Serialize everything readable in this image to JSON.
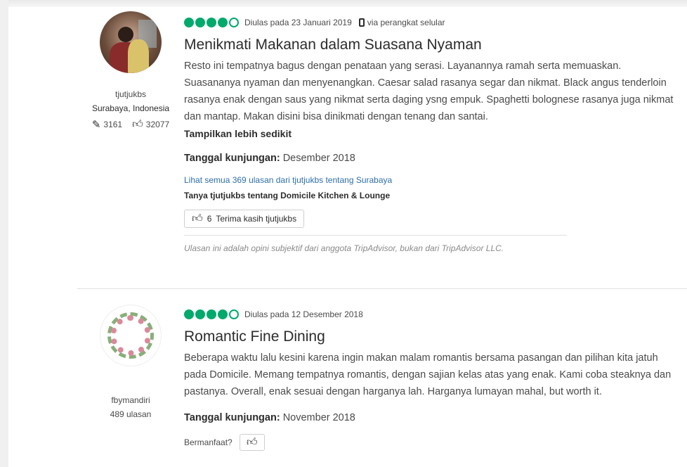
{
  "reviews": [
    {
      "member": {
        "name": "tjutjukbs",
        "location": "Surabaya, Indonesia",
        "contributions": "3161",
        "helpful_votes": "32077",
        "avatar_icon": "member-photo",
        "contrib_icon": "edit-icon",
        "votes_icon": "thumbs-up-icon"
      },
      "rating": 4,
      "reviewed_text": "Diulas pada 23 Januari 2019",
      "via_text": "via perangkat selular",
      "title": "Menikmati Makanan dalam Suasana Nyaman",
      "body": "Resto ini tempatnya bagus dengan penataan yang serasi. Layanannya ramah serta memuaskan. Suasananya nyaman dan menyenangkan. Caesar salad rasanya segar dan nikmat. Black angus tenderloin rasanya enak dengan saus yang nikmat serta daging ysng empuk. Spaghetti bolognese rasanya juga nikmat dan mantap. Makan disini bisa dinikmati dengan tenang dan santai.",
      "show_less": "Tampilkan lebih sedikit",
      "visit_label": "Tanggal kunjungan:",
      "visit_value": " Desember 2018",
      "see_all": "Lihat semua 369 ulasan dari tjutjukbs tentang Surabaya",
      "ask": "Tanya tjutjukbs tentang Domicile Kitchen & Lounge",
      "thanks_count": "6",
      "thanks_label": "Terima kasih tjutjukbs",
      "disclaimer": "Ulasan ini adalah opini subjektif dari anggota TripAdvisor, bukan dari TripAdvisor LLC."
    },
    {
      "member": {
        "name": "fbymandiri",
        "reviews_count": "489 ulasan",
        "avatar_icon": "floral-wreath-avatar"
      },
      "rating": 4,
      "reviewed_text": "Diulas pada 12 Desember 2018",
      "title": "Romantic Fine Dining",
      "body": "Beberapa waktu lalu kesini karena ingin makan malam romantis bersama pasangan dan pilihan kita jatuh pada Domicile. Memang tempatnya romantis, dengan sajian kelas atas yang enak. Kami coba steaknya dan pastanya. Overall, enak sesuai dengan harganya lah. Harganya lumayan mahal, but worth it.",
      "visit_label": "Tanggal kunjungan:",
      "visit_value": " November 2018",
      "helpful_label": "Bermanfaat?"
    }
  ],
  "colors": {
    "bubble": "#00aa6c",
    "link": "#2f6fa8",
    "text": "#4a4a4a"
  }
}
